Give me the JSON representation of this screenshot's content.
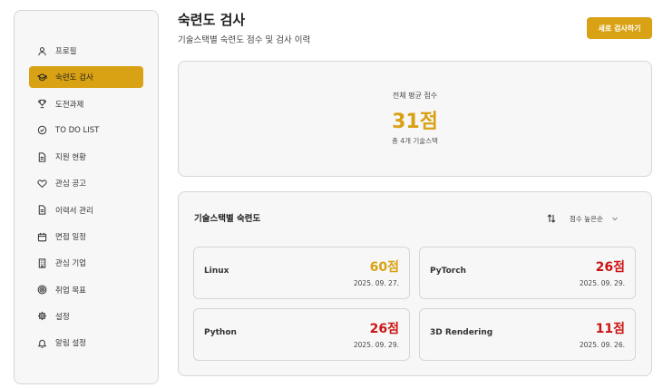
{
  "sidebar": {
    "items": [
      {
        "label": "프로필",
        "icon": "user-icon",
        "active": false
      },
      {
        "label": "숙련도 검사",
        "icon": "graduation-cap-icon",
        "active": true
      },
      {
        "label": "도전과제",
        "icon": "trophy-icon",
        "active": false
      },
      {
        "label": "TO DO LIST",
        "icon": "check-circle-icon",
        "active": false
      },
      {
        "label": "지원 현황",
        "icon": "document-icon",
        "active": false
      },
      {
        "label": "관심 공고",
        "icon": "heart-icon",
        "active": false
      },
      {
        "label": "이력서 관리",
        "icon": "document-icon",
        "active": false
      },
      {
        "label": "면접 일정",
        "icon": "calendar-icon",
        "active": false
      },
      {
        "label": "관심 기업",
        "icon": "building-icon",
        "active": false
      },
      {
        "label": "취업 목표",
        "icon": "target-icon",
        "active": false
      },
      {
        "label": "설정",
        "icon": "gear-icon",
        "active": false
      },
      {
        "label": "알림 설정",
        "icon": "bell-icon",
        "active": false
      }
    ]
  },
  "header": {
    "title": "숙련도 검사",
    "subtitle": "기술스택별 숙련도 점수 및 검사 이력",
    "new_test_label": "새로 검사하기"
  },
  "summary": {
    "label": "전체 평균 점수",
    "value": "31점",
    "sub": "총 4개 기술스택"
  },
  "skills_section": {
    "title": "기술스택별 숙련도",
    "sort_label": "점수 높은순",
    "items": [
      {
        "name": "Linux",
        "score": "60점",
        "date": "2025. 09. 27.",
        "color": "#d9a114"
      },
      {
        "name": "PyTorch",
        "score": "26점",
        "date": "2025. 09. 29.",
        "color": "#cc1414"
      },
      {
        "name": "Python",
        "score": "26점",
        "date": "2025. 09. 29.",
        "color": "#cc1414"
      },
      {
        "name": "3D Rendering",
        "score": "11점",
        "date": "2025. 09. 26.",
        "color": "#cc1414"
      }
    ]
  },
  "colors": {
    "accent": "#d9a114",
    "low_score": "#cc1414"
  }
}
